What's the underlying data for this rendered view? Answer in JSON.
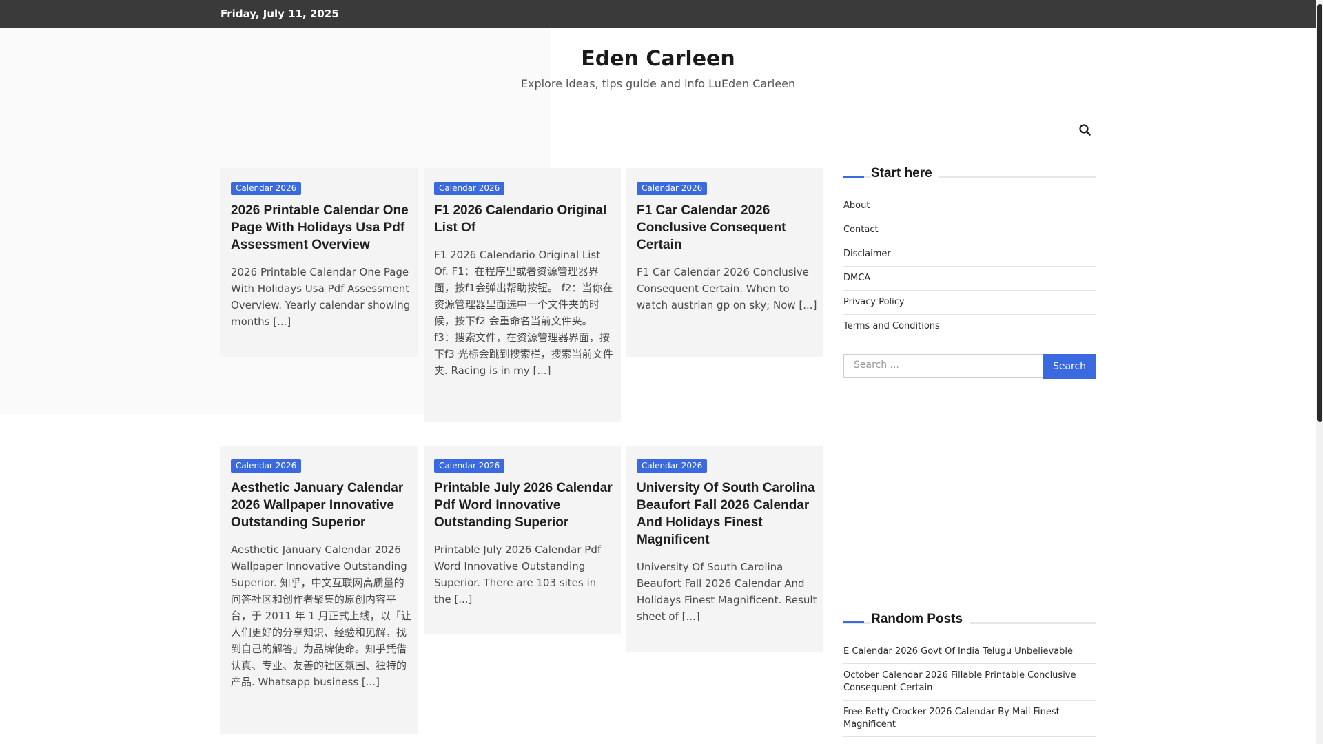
{
  "topbar": {
    "date": "Friday, July 11, 2025"
  },
  "site": {
    "title": "Eden Carleen",
    "description": "Explore ideas, tips guide and info LuEden Carleen"
  },
  "posts": [
    {
      "category": "Calendar 2026",
      "title": "2026 Printable Calendar One Page With Holidays Usa Pdf Assessment Overview",
      "excerpt": "2026 Printable Calendar One Page With Holidays Usa Pdf Assessment Overview. Yearly calendar showing months [...]"
    },
    {
      "category": "Calendar 2026",
      "title": "F1 2026 Calendario Original List Of",
      "excerpt": "F1 2026 Calendario Original List Of. F1：在程序里或者资源管理器界面，按f1会弹出帮助按钮。 f2：当你在资源管理器里面选中一个文件夹的时候，按下f2 会重命名当前文件夹。 f3：搜索文件，在资源管理器界面，按下f3 光标会跳到搜索栏，搜索当前文件夹. Racing is in my [...]"
    },
    {
      "category": "Calendar 2026",
      "title": "F1 Car Calendar 2026 Conclusive Consequent Certain",
      "excerpt": "F1 Car Calendar 2026 Conclusive Consequent Certain. When to watch austrian gp on sky; Now [...]"
    },
    {
      "category": "Calendar 2026",
      "title": "Aesthetic January Calendar 2026 Wallpaper Innovative Outstanding Superior",
      "excerpt": "Aesthetic January Calendar 2026 Wallpaper Innovative Outstanding Superior. 知乎，中文互联网高质量的问答社区和创作者聚集的原创内容平台，于 2011 年 1 月正式上线，以「让人们更好的分享知识、经验和见解，找到自己的解答」为品牌使命。知乎凭借认真、专业、友善的社区氛围、独特的产品. Whatsapp business [...]"
    },
    {
      "category": "Calendar 2026",
      "title": "Printable July 2026 Calendar Pdf Word Innovative Outstanding Superior",
      "excerpt": "Printable July 2026 Calendar Pdf Word Innovative Outstanding Superior. There are 103 sites in the [...]"
    },
    {
      "category": "Calendar 2026",
      "title": "University Of South Carolina Beaufort Fall 2026 Calendar And Holidays Finest Magnificent",
      "excerpt": "University Of South Carolina Beaufort Fall 2026 Calendar And Holidays Finest Magnificent. Result sheet of [...]"
    }
  ],
  "sidebar": {
    "start_here": {
      "title": "Start here",
      "links": [
        "About",
        "Contact",
        "Disclaimer",
        "DMCA",
        "Privacy Policy",
        "Terms and Conditions"
      ]
    },
    "search": {
      "placeholder": "Search ...",
      "button": "Search"
    },
    "random_posts": {
      "title": "Random Posts",
      "links": [
        "E Calendar 2026 Govt Of India Telugu Unbelievable",
        "October Calendar 2026 Fillable Printable Conclusive Consequent Certain",
        "Free Betty Crocker 2026 Calendar By Mail Finest Magnificent"
      ]
    }
  },
  "colors": {
    "accent": "#3b6ae0",
    "topbar": "#3a3a3a"
  },
  "icons": {
    "header_search": "search-icon"
  }
}
